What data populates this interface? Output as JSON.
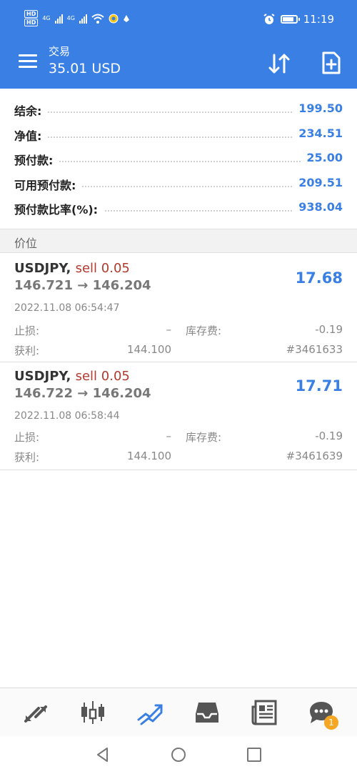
{
  "status_bar": {
    "hd1": "HD",
    "hd2": "HD",
    "net1": "4G",
    "net2": "4G",
    "time": "11:19"
  },
  "header": {
    "title": "交易",
    "subtitle": "35.01 USD"
  },
  "summary": [
    {
      "label": "结余:",
      "value": "199.50"
    },
    {
      "label": "净值:",
      "value": "234.51"
    },
    {
      "label": "预付款:",
      "value": "25.00"
    },
    {
      "label": "可用预付款:",
      "value": "209.51"
    },
    {
      "label": "预付款比率(%):",
      "value": "938.04"
    }
  ],
  "section_title": "价位",
  "orders": [
    {
      "symbol": "USDJPY,",
      "side": "sell 0.05",
      "prices": "146.721 → 146.204",
      "profit": "17.68",
      "time": "2022.11.08 06:54:47",
      "sl_label": "止损:",
      "sl_value": "–",
      "swap_label": "库存费:",
      "swap_value": "-0.19",
      "tp_label": "获利:",
      "tp_value": "144.100",
      "ticket": "#3461633"
    },
    {
      "symbol": "USDJPY,",
      "side": "sell 0.05",
      "prices": "146.722 → 146.204",
      "profit": "17.71",
      "time": "2022.11.08 06:58:44",
      "sl_label": "止损:",
      "sl_value": "–",
      "swap_label": "库存费:",
      "swap_value": "-0.19",
      "tp_label": "获利:",
      "tp_value": "144.100",
      "ticket": "#3461639"
    }
  ],
  "bottom_nav": {
    "items": [
      "quotes-icon",
      "chart-icon",
      "trade-icon",
      "history-icon",
      "news-icon",
      "chat-icon"
    ],
    "active": "trade-icon",
    "chat_badge": "1"
  },
  "colors": {
    "primary": "#3a7fe3",
    "sell": "#b23a2e",
    "badge": "#f5a623"
  },
  "battery_level": 0.85
}
